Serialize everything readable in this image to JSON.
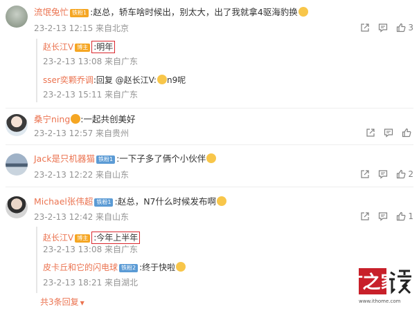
{
  "comments": [
    {
      "user": "流氓兔忙",
      "badge": "铁粉1",
      "text": ":赵总，轿车啥时候出，别太大，出了我就拿4驱海豹换",
      "meta": "23-2-13 12:15 来自北京",
      "likes": "3",
      "replies": [
        {
          "user": "赵长江V",
          "badge": "博主",
          "text": ":明年",
          "meta": "23-2-13 13:08 来自广东"
        },
        {
          "user": "sser奕颗乔调",
          "text": ":回复 @赵长江V:",
          "text2": "n9呢",
          "meta": "23-2-13 15:11 来自广东"
        }
      ]
    },
    {
      "user": "桑宁ning",
      "text": ":一起共创美好",
      "meta": "23-2-13 12:57 来自贵州",
      "likes": ""
    },
    {
      "user": "Jack是只机器猫",
      "badge": "铁粉1",
      "text": ":一下子多了俩个小伙伴",
      "meta": "23-2-13 12:22 来自山东",
      "likes": "2"
    },
    {
      "user": "Michael张伟超",
      "badge": "铁粉1",
      "text": ":赵总，N7什么时候发布啊",
      "meta": "23-2-13 12:42 来自山东",
      "likes": "1",
      "replies": [
        {
          "user": "赵长江V",
          "badge": "博主",
          "text": ":今年上半年",
          "meta": "23-2-13 13:08 来自广东"
        },
        {
          "user": "皮卡丘和它的闪电球",
          "badge": "铁粉2",
          "text": ":终于快啦",
          "meta": "23-2-13 18:21 来自湖北"
        }
      ],
      "more": "共3条回复"
    }
  ],
  "watermark": {
    "brand": "IT之家",
    "url": "www.ithome.com"
  },
  "icons": [
    "share-icon",
    "comment-icon",
    "like-icon"
  ],
  "colors": {
    "username": "#eb7350",
    "highlight": "#d9262c",
    "meta": "#939393"
  }
}
